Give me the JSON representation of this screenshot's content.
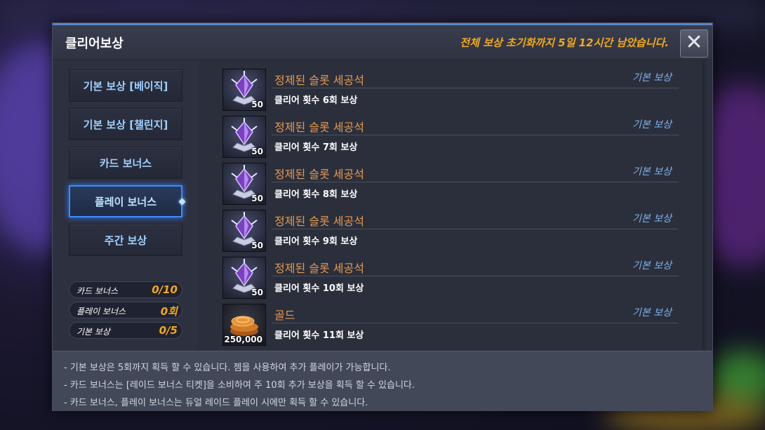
{
  "window": {
    "title": "클리어보상",
    "reset_notice": "전체 보상 초기화까지 5일 12시간 남았습니다.",
    "close_label": "✕"
  },
  "sidebar": {
    "tabs": [
      {
        "label": "기본 보상 [베이직]",
        "active": false
      },
      {
        "label": "기본 보상 [챌린지]",
        "active": false
      },
      {
        "label": "카드 보너스",
        "active": false
      },
      {
        "label": "플레이 보너스",
        "active": true
      },
      {
        "label": "주간 보상",
        "active": false
      }
    ],
    "stats": [
      {
        "label": "카드 보너스",
        "value": "0/10"
      },
      {
        "label": "플레이 보너스",
        "value": "0회"
      },
      {
        "label": "기본 보상",
        "value": "0/5"
      }
    ]
  },
  "rewards": [
    {
      "name": "정제된 슬롯 세공석",
      "type": "기본 보상",
      "condition": "클리어 횟수 6회 보상",
      "quantity": "50",
      "icon": "slot-gem-icon"
    },
    {
      "name": "정제된 슬롯 세공석",
      "type": "기본 보상",
      "condition": "클리어 횟수 7회 보상",
      "quantity": "50",
      "icon": "slot-gem-icon"
    },
    {
      "name": "정제된 슬롯 세공석",
      "type": "기본 보상",
      "condition": "클리어 횟수 8회 보상",
      "quantity": "50",
      "icon": "slot-gem-icon"
    },
    {
      "name": "정제된 슬롯 세공석",
      "type": "기본 보상",
      "condition": "클리어 횟수 9회 보상",
      "quantity": "50",
      "icon": "slot-gem-icon"
    },
    {
      "name": "정제된 슬롯 세공석",
      "type": "기본 보상",
      "condition": "클리어 횟수 10회 보상",
      "quantity": "50",
      "icon": "slot-gem-icon"
    },
    {
      "name": "골드",
      "type": "기본 보상",
      "condition": "클리어 횟수 11회 보상",
      "quantity": "250,000",
      "icon": "gold-coins-icon"
    }
  ],
  "footer": {
    "notes": [
      "- 기본 보상은 5회까지 획득 할 수 있습니다. 젬을 사용하여 추가 플레이가 가능합니다.",
      "- 카드 보너스는 [레이드 보너스 티켓]을 소비하여 주 10회 추가 보상을 획득 할 수 있습니다.",
      "- 카드 보너스, 플레이 보너스는 듀얼 레이드 플레이 시에만 획득 할 수 있습니다."
    ]
  },
  "colors": {
    "accent_orange": "#f2a91c",
    "item_name": "#e79a4f",
    "tab_text": "#9fd0ff",
    "active_tab_border": "#3a8dff",
    "reward_type": "#7fb4ee"
  }
}
